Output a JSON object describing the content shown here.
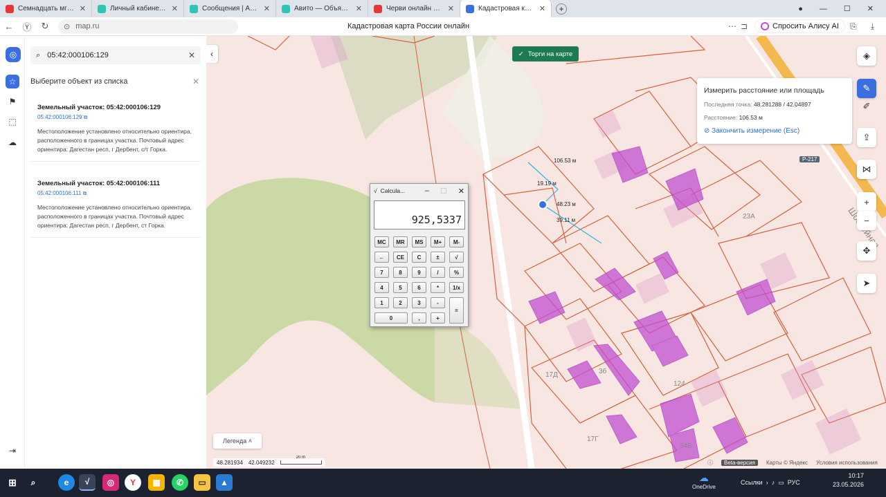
{
  "browser": {
    "tabs": [
      {
        "title": "Семнадцать мгновений в",
        "color": "#e53935"
      },
      {
        "title": "Личный кабинет - Объяв",
        "color": "#2ec4b6"
      },
      {
        "title": "Сообщения | Авито",
        "color": "#2ec4b6"
      },
      {
        "title": "Авито — Объявления на с",
        "color": "#2ec4b6"
      },
      {
        "title": "Черви онлайн играть бес",
        "color": "#e53935"
      },
      {
        "title": "Кадастровая карта Рос",
        "color": "#3b6fe0",
        "active": true
      }
    ],
    "url": "map.ru",
    "page_title": "Кадастровая карта России онлайн",
    "alice_label": "Спросить Алису AI"
  },
  "panel": {
    "search_value": "05:42:000106:129",
    "header": "Выберите объект из списка",
    "results": [
      {
        "title": "Земельный участок: 05:42:000106:129",
        "id": "05:42:000106:129",
        "desc": "Местоположение установлено относительно ориентира, расположенного в границах участка. Почтовый адрес ориентира: Дагестан респ, г Дербент, с/т Горка."
      },
      {
        "title": "Земельный участок: 05:42:000106:111",
        "id": "05:42:000106:111",
        "desc": "Местоположение установлено относительно ориентира, расположенного в границах участка. Почтовый адрес ориентира: Дагестан респ, г Дербент, ст Горка."
      }
    ]
  },
  "map": {
    "torgi_label": "Торги на карте",
    "measure": {
      "title": "Измерить расстояние или площадь",
      "last_point_label": "Последняя точка:",
      "last_point_value": "48.281288 / 42.04897",
      "distance_label": "Расстояние:",
      "distance_value": "106.53 м",
      "finish_label": "Закончить измерение (Esc)"
    },
    "segments": {
      "total": "106.53 м",
      "s1": "19.19 м",
      "s2": "48.23 м",
      "s3": "39.11 м"
    },
    "labels": {
      "road": "Р-217",
      "street": "Шоссейная",
      "h23a": "23А",
      "h17d": "17Д",
      "h3": "3б",
      "h124": "124",
      "h17g": "17Г",
      "h34b": "34Б"
    },
    "legend_label": "Легенда",
    "coords": {
      "lat": "48.281934",
      "lon": "42.049232",
      "scale": "20 m"
    },
    "footer": {
      "beta": "Beta-версия",
      "maps": "Карты © Яндекс",
      "terms": "Условия использования"
    }
  },
  "calculator": {
    "title": "Calcula...",
    "display": "925,5337",
    "rows": [
      [
        "MC",
        "MR",
        "MS",
        "M+",
        "M-"
      ],
      [
        "←",
        "CE",
        "C",
        "±",
        "√"
      ],
      [
        "7",
        "8",
        "9",
        "/",
        "%"
      ],
      [
        "4",
        "5",
        "6",
        "*",
        "1/x"
      ],
      [
        "1",
        "2",
        "3",
        "-",
        "="
      ],
      [
        "0",
        ",",
        "+"
      ]
    ]
  },
  "taskbar": {
    "onedrive": "OneDrive",
    "links": "Ссылки",
    "lang": "РУС",
    "time": "10:17",
    "date": "23.05.2026"
  }
}
